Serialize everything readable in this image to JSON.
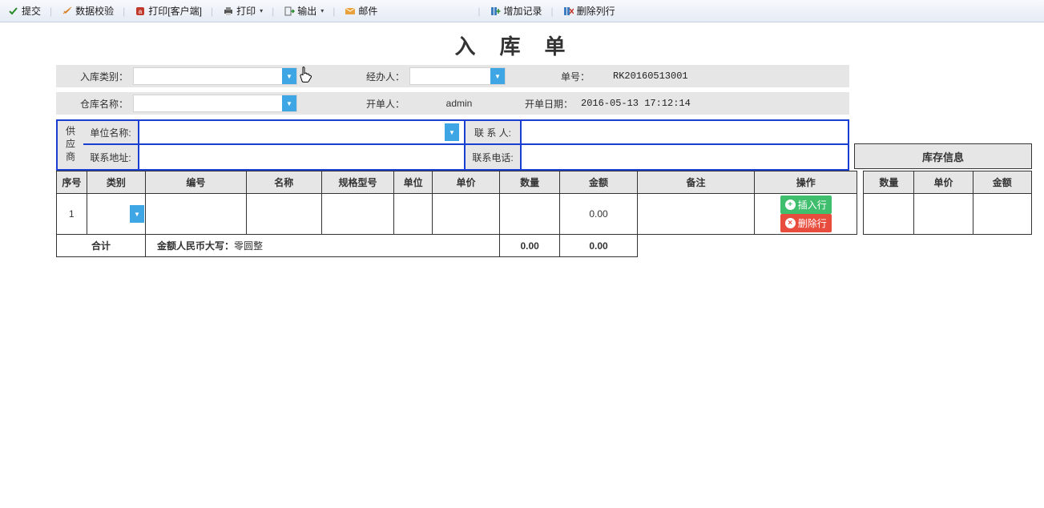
{
  "toolbar": {
    "submit": "提交",
    "validate": "数据校验",
    "print_client": "打印[客户端]",
    "print": "打印",
    "export": "输出",
    "email": "邮件",
    "add_row": "增加记录",
    "del_row": "删除列行"
  },
  "title": "入库单",
  "form": {
    "inbound_type_label": "入库类别：",
    "inbound_type_value": "",
    "handler_label": "经办人：",
    "handler_value": "",
    "doc_no_label": "单号：",
    "doc_no_value": "RK20160513001",
    "warehouse_label": "仓库名称：",
    "warehouse_value": "",
    "issuer_label": "开单人：",
    "issuer_value": "admin",
    "issue_date_label": "开单日期：",
    "issue_date_value": "2016-05-13 17:12:14"
  },
  "supplier": {
    "side": "供应商",
    "unit_name_label": "单位名称:",
    "unit_name_value": "",
    "contact_label": "联 系 人:",
    "contact_value": "",
    "address_label": "联系地址:",
    "address_value": "",
    "phone_label": "联系电话:",
    "phone_value": ""
  },
  "stock_header": "库存信息",
  "table": {
    "headers": {
      "no": "序号",
      "category": "类别",
      "code": "编号",
      "name": "名称",
      "spec": "规格型号",
      "unit": "单位",
      "price": "单价",
      "qty": "数量",
      "amount": "金额",
      "remark": "备注",
      "operation": "操作",
      "stock_qty": "数量",
      "stock_price": "单价",
      "stock_amount": "金额"
    },
    "rows": [
      {
        "no": "1",
        "category": "",
        "code": "",
        "name": "",
        "spec": "",
        "unit": "",
        "price": "",
        "qty": "",
        "amount": "0.00",
        "remark": "",
        "stock_qty": "",
        "stock_price": "",
        "stock_amount": ""
      }
    ],
    "op_insert": "插入行",
    "op_delete": "删除行",
    "sum_label": "合计",
    "sum_text_prefix": "金额人民币大写：",
    "sum_text_value": "零圆整",
    "sum_qty": "0.00",
    "sum_amount": "0.00"
  }
}
